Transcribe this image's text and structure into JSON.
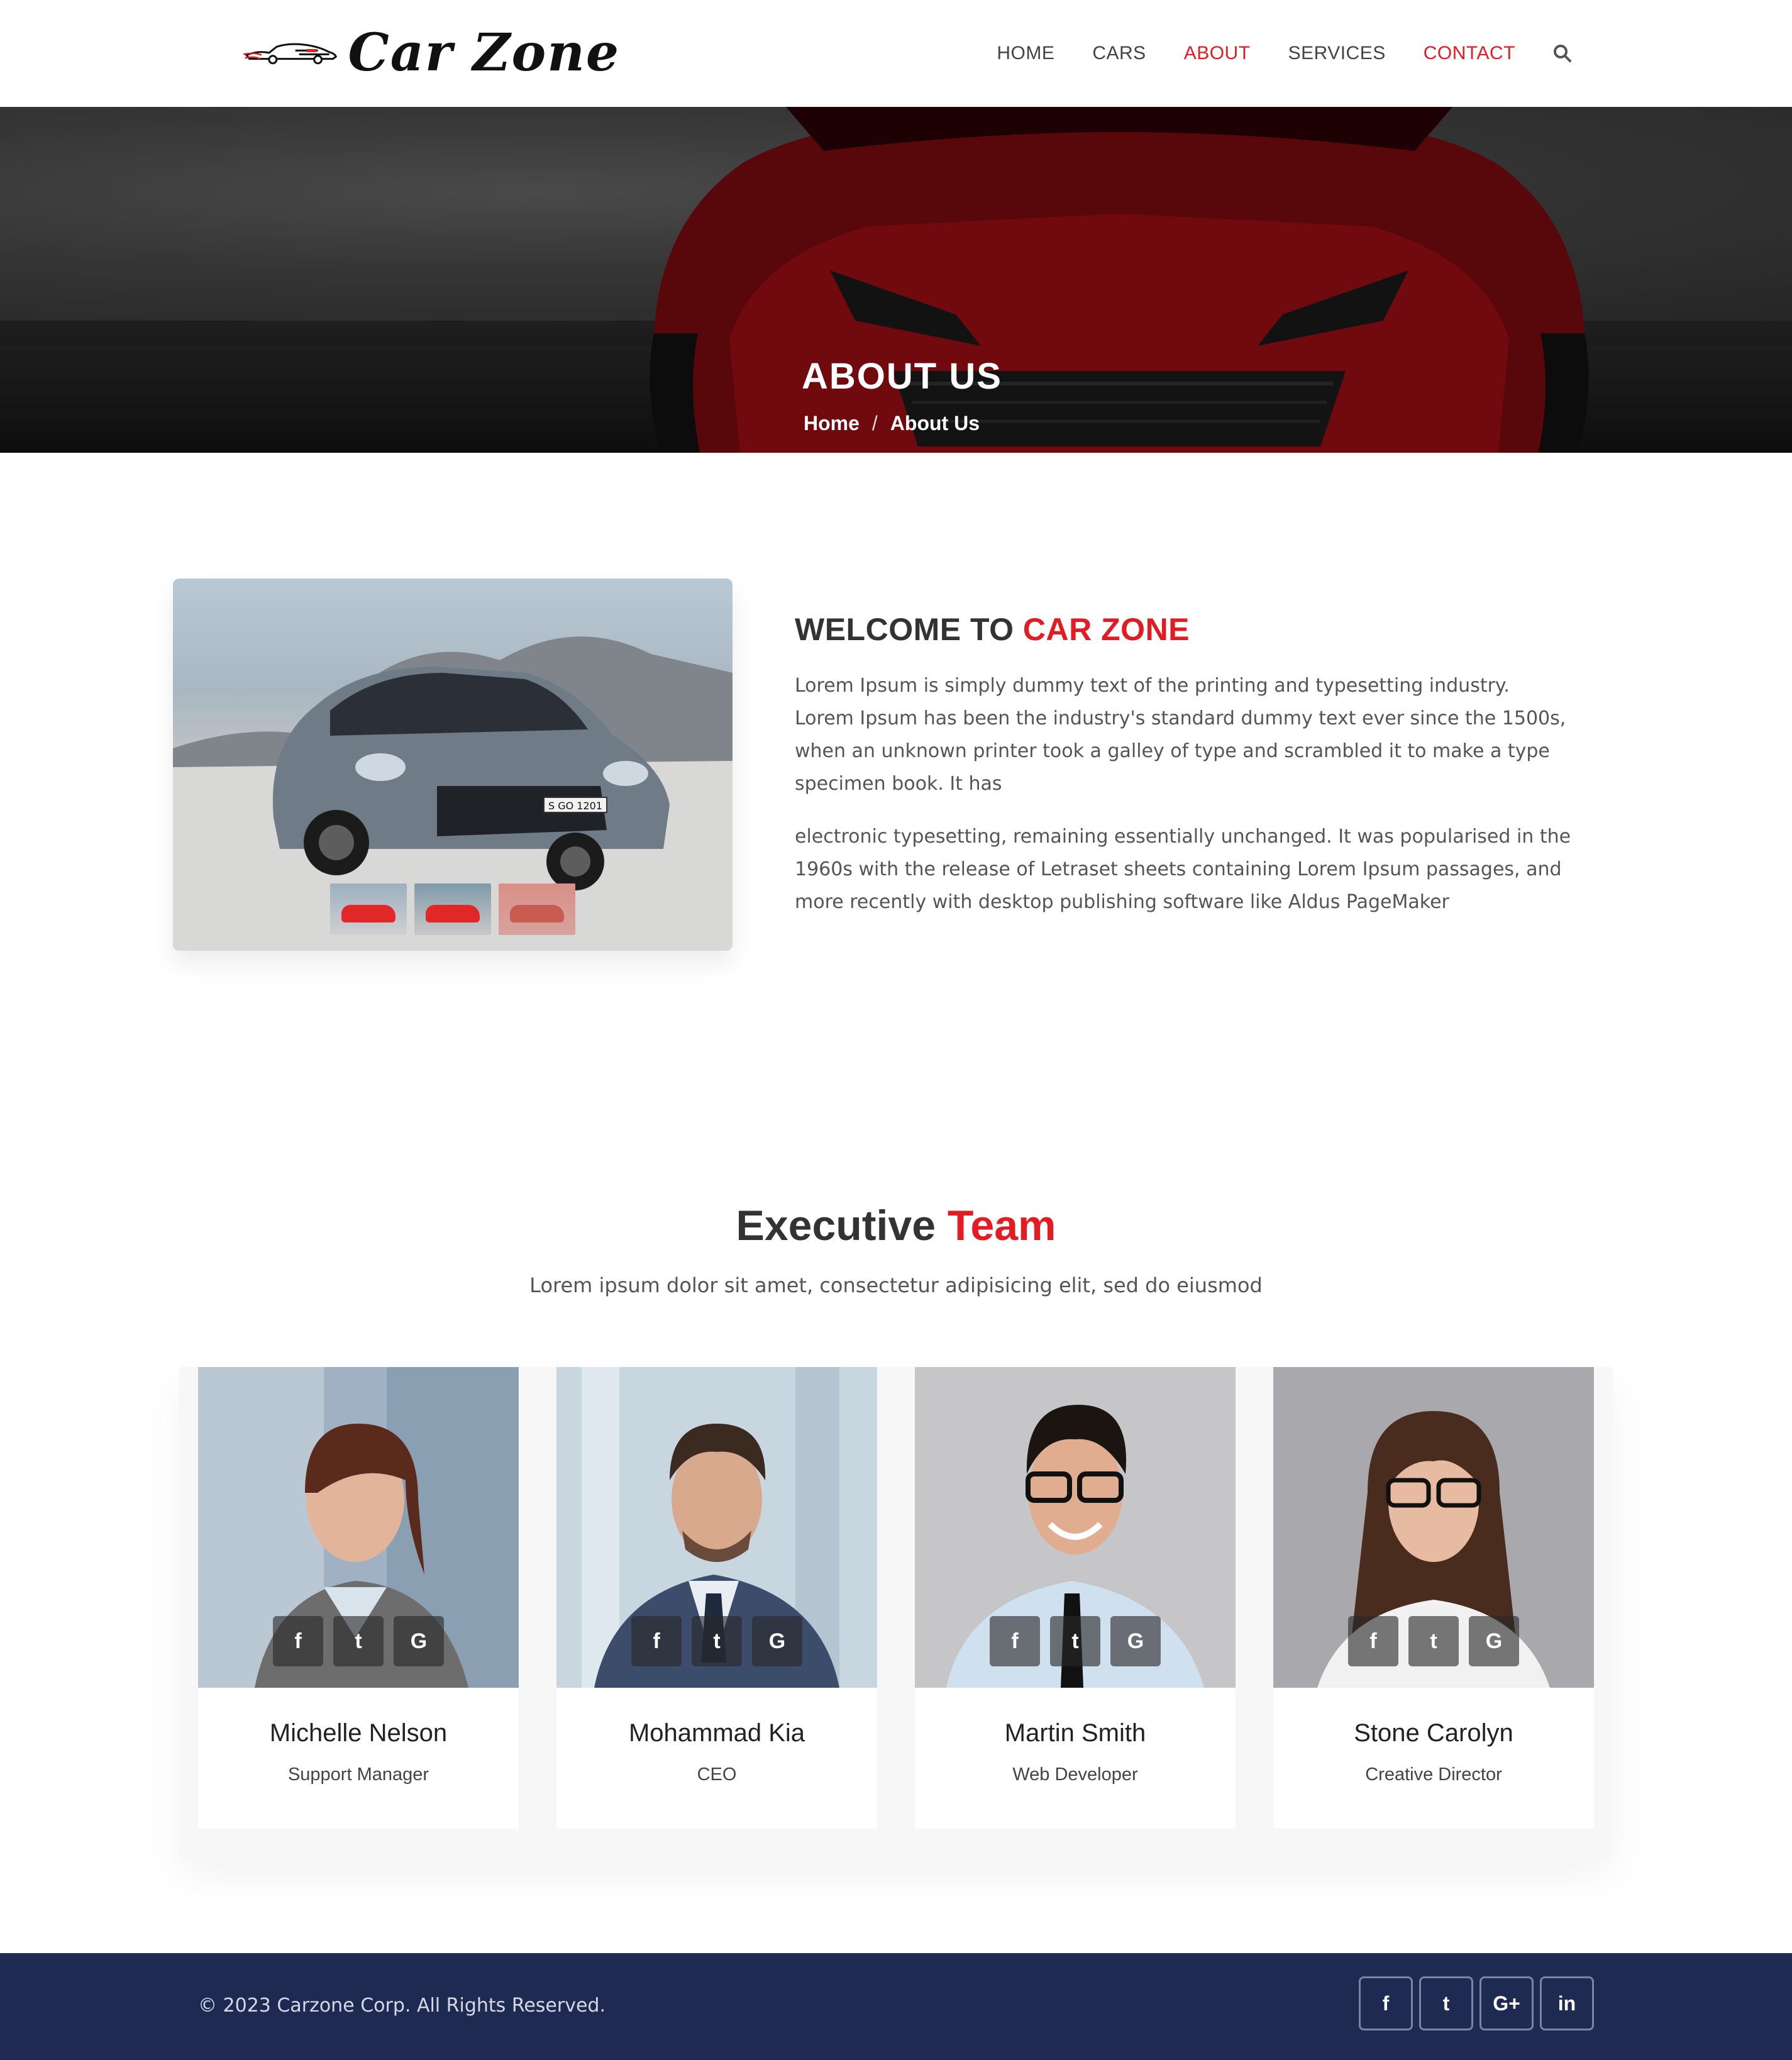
{
  "brand": {
    "name": "Car Zone"
  },
  "nav": {
    "items": [
      {
        "label": "HOME",
        "active": false
      },
      {
        "label": "CARS",
        "active": false
      },
      {
        "label": "ABOUT",
        "active": true
      },
      {
        "label": "SERVICES",
        "active": false
      },
      {
        "label": "CONTACT",
        "active": true
      }
    ],
    "search_icon": "search-icon"
  },
  "hero": {
    "title": "ABOUT US",
    "breadcrumb": {
      "home": "Home",
      "separator": "/",
      "current": "About Us"
    }
  },
  "about": {
    "heading_prefix": "WELCOME TO",
    "heading_highlight": "CAR ZONE",
    "paragraph_1": "Lorem Ipsum is simply dummy text of the printing and typesetting industry. Lorem Ipsum has been the industry's standard dummy text ever since the 1500s, when an unknown printer took a galley of type and scrambled it to make a type specimen book. It has",
    "paragraph_2": "electronic typesetting, remaining essentially unchanged. It was popularised in the 1960s with the release of Letraset sheets containing Lorem Ipsum passages, and more recently with desktop publishing software like Aldus PageMaker",
    "plate_text": "S GO 1201"
  },
  "team": {
    "title_prefix": "Executive",
    "title_highlight": "Team",
    "subtitle": "Lorem ipsum dolor sit amet, consectetur adipisicing elit, sed do eiusmod",
    "social_glyphs": {
      "facebook": "f",
      "twitter": "t",
      "google": "G"
    },
    "members": [
      {
        "name": "Michelle Nelson",
        "role": "Support Manager"
      },
      {
        "name": "Mohammad Kia",
        "role": "CEO"
      },
      {
        "name": "Martin Smith",
        "role": "Web Developer"
      },
      {
        "name": "Stone Carolyn",
        "role": "Creative Director"
      }
    ]
  },
  "footer": {
    "copyright": "© 2023 Carzone Corp. All Rights Reserved.",
    "social": [
      {
        "icon": "facebook-icon",
        "glyph": "f"
      },
      {
        "icon": "twitter-icon",
        "glyph": "t"
      },
      {
        "icon": "google-plus-icon",
        "glyph": "G+"
      },
      {
        "icon": "linkedin-icon",
        "glyph": "in"
      }
    ]
  },
  "colors": {
    "accent": "#e31b23",
    "footer_bg": "#1f2a52",
    "text": "#333333"
  }
}
